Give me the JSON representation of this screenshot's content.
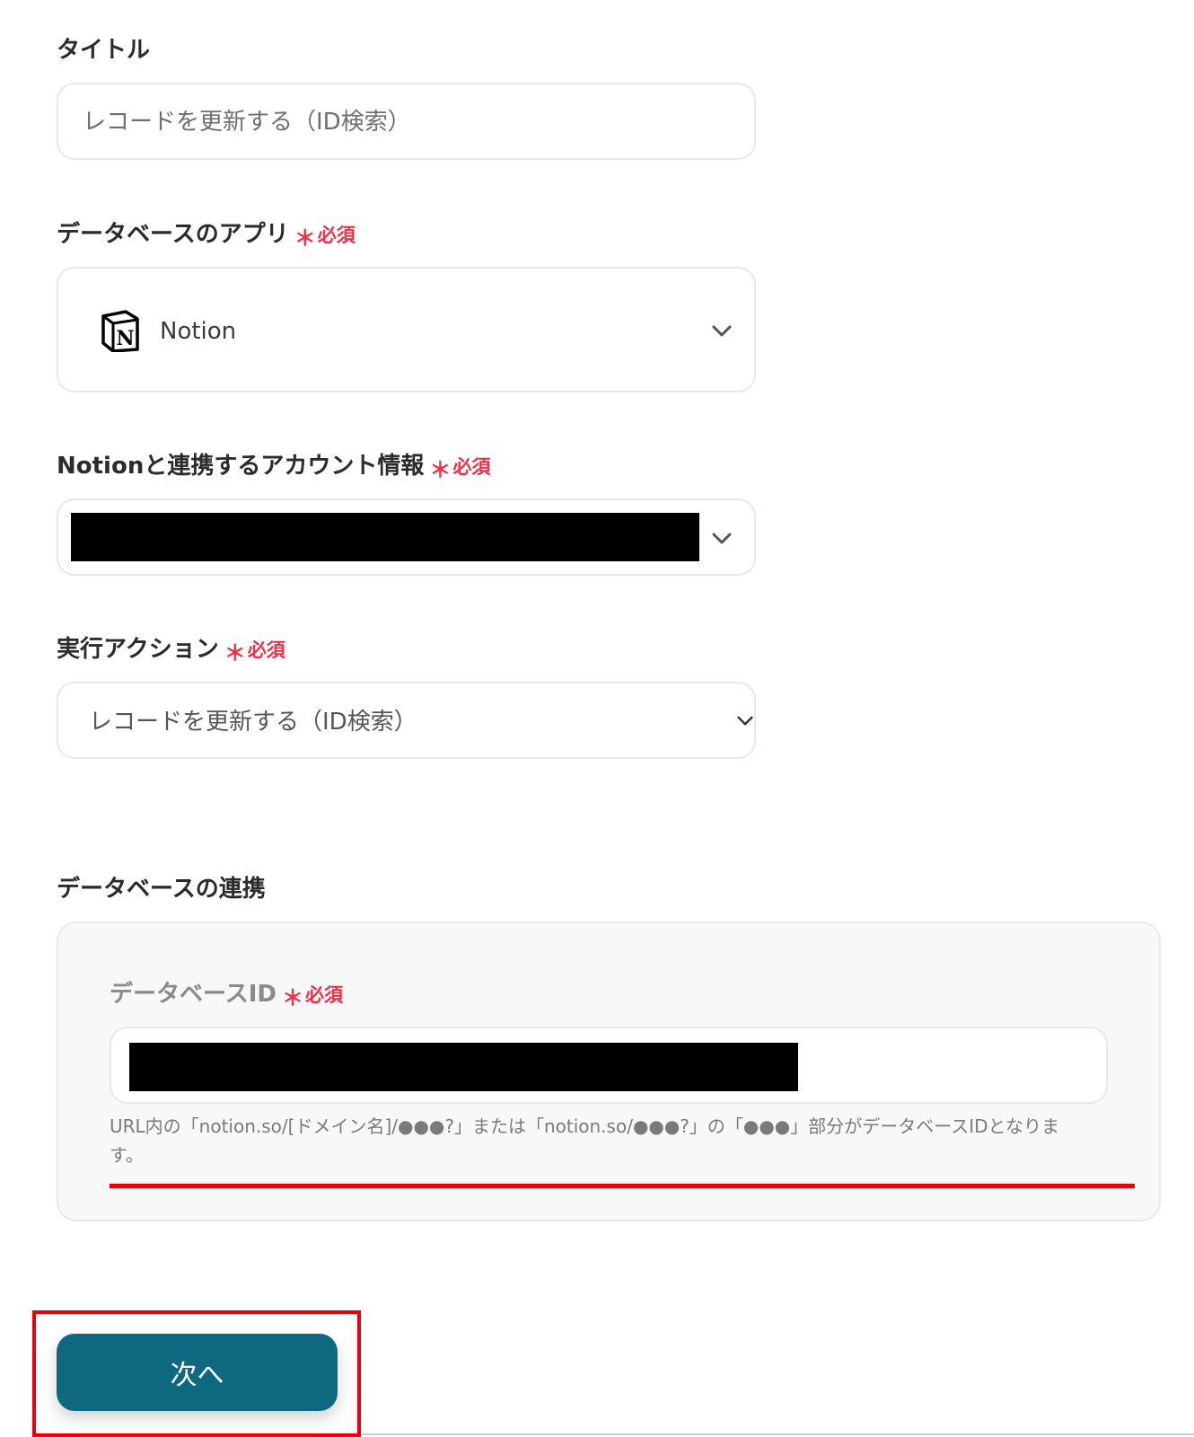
{
  "title_field": {
    "label": "タイトル",
    "value": "レコードを更新する（ID検索）"
  },
  "database_app": {
    "label": "データベースのアプリ",
    "required_mark": "＊",
    "required_text": "必須",
    "selected": "Notion",
    "icon": "notion-logo-icon"
  },
  "account": {
    "label": "Notionと連携するアカウント情報",
    "required_mark": "＊",
    "required_text": "必須"
  },
  "action": {
    "label": "実行アクション",
    "required_mark": "＊",
    "required_text": "必須",
    "selected": "レコードを更新する（ID検索）"
  },
  "db_link": {
    "section_title": "データベースの連携",
    "id_label": "データベースID",
    "required_mark": "＊",
    "required_text": "必須",
    "help_text": "URL内の「notion.so/[ドメイン名]/●●●?」または「notion.so/●●●?」の「●●●」部分がデータベースIDとなります。"
  },
  "next_button": {
    "label": "次へ"
  },
  "colors": {
    "required": "#e8334a",
    "primary_button": "#0d6880",
    "highlight": "#e60012"
  }
}
